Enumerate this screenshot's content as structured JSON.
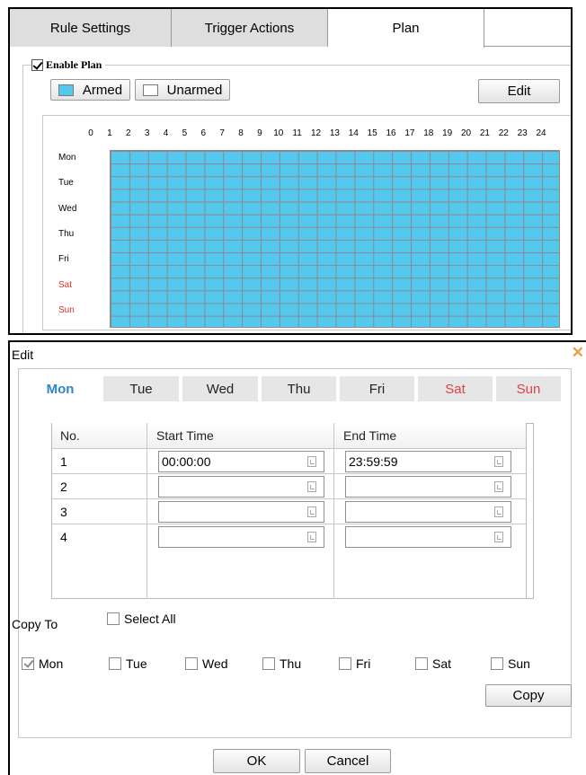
{
  "plan_panel": {
    "tabs": [
      {
        "label": "Rule Settings",
        "active": false
      },
      {
        "label": "Trigger Actions",
        "active": false
      },
      {
        "label": "Plan",
        "active": true
      }
    ],
    "enable_plan": {
      "label": "Enable Plan",
      "checked": true
    },
    "legend": {
      "armed": {
        "label": "Armed",
        "color": "#55c8ee"
      },
      "unarmed": {
        "label": "Unarmed",
        "color": "#ffffff"
      }
    },
    "edit_button": "Edit",
    "hours": [
      "0",
      "1",
      "2",
      "3",
      "4",
      "5",
      "6",
      "7",
      "8",
      "9",
      "10",
      "11",
      "12",
      "13",
      "14",
      "15",
      "16",
      "17",
      "18",
      "19",
      "20",
      "21",
      "22",
      "23",
      "24"
    ],
    "days": [
      {
        "label": "Mon",
        "weekend": false
      },
      {
        "label": "Tue",
        "weekend": false
      },
      {
        "label": "Wed",
        "weekend": false
      },
      {
        "label": "Thu",
        "weekend": false
      },
      {
        "label": "Fri",
        "weekend": false
      },
      {
        "label": "Sat",
        "weekend": true
      },
      {
        "label": "Sun",
        "weekend": true
      }
    ],
    "all_armed": true
  },
  "edit_dialog": {
    "title": "Edit",
    "close_glyph": "✕",
    "day_tabs": [
      {
        "label": "Mon",
        "active": true,
        "weekend": false
      },
      {
        "label": "Tue",
        "active": false,
        "weekend": false
      },
      {
        "label": "Wed",
        "active": false,
        "weekend": false
      },
      {
        "label": "Thu",
        "active": false,
        "weekend": false
      },
      {
        "label": "Fri",
        "active": false,
        "weekend": false
      },
      {
        "label": "Sat",
        "active": false,
        "weekend": true
      },
      {
        "label": "Sun",
        "active": false,
        "weekend": true
      }
    ],
    "table": {
      "headers": {
        "no": "No.",
        "start": "Start Time",
        "end": "End Time"
      },
      "rows": [
        {
          "no": "1",
          "start": "00:00:00",
          "end": "23:59:59"
        },
        {
          "no": "2",
          "start": "",
          "end": ""
        },
        {
          "no": "3",
          "start": "",
          "end": ""
        },
        {
          "no": "4",
          "start": "",
          "end": ""
        }
      ]
    },
    "copy_to": {
      "label": "Copy To",
      "select_all": {
        "label": "Select All",
        "checked": false
      },
      "days": [
        {
          "label": "Mon",
          "checked": true
        },
        {
          "label": "Tue",
          "checked": false
        },
        {
          "label": "Wed",
          "checked": false
        },
        {
          "label": "Thu",
          "checked": false
        },
        {
          "label": "Fri",
          "checked": false
        },
        {
          "label": "Sat",
          "checked": false
        },
        {
          "label": "Sun",
          "checked": false
        }
      ],
      "copy_button": "Copy"
    },
    "ok_button": "OK",
    "cancel_button": "Cancel"
  }
}
